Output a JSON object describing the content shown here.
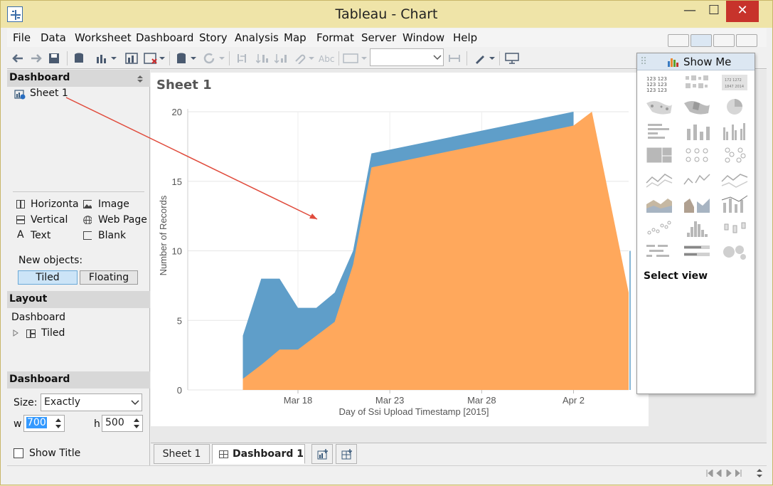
{
  "window": {
    "title": "Tableau - Chart",
    "min": "—",
    "max": "☐",
    "close": "✕"
  },
  "menu": [
    "File",
    "Data",
    "Worksheet",
    "Dashboard",
    "Story",
    "Analysis",
    "Map",
    "Format",
    "Server",
    "Window",
    "Help"
  ],
  "left_panel": {
    "dashboard_header": "Dashboard",
    "sheets": [
      "Sheet 1"
    ],
    "objects": [
      {
        "label": "Horizonta",
        "icon": "horizontal-icon"
      },
      {
        "label": "Image",
        "icon": "image-icon"
      },
      {
        "label": "Vertical",
        "icon": "vertical-icon"
      },
      {
        "label": "Web Page",
        "icon": "globe-icon"
      },
      {
        "label": "Text",
        "icon": "text-icon"
      },
      {
        "label": "Blank",
        "icon": "blank-icon"
      }
    ],
    "new_objects_label": "New objects:",
    "tiled": "Tiled",
    "floating": "Floating",
    "layout_header": "Layout",
    "layout_root": "Dashboard",
    "layout_child": "Tiled",
    "size_header": "Dashboard",
    "size_label": "Size:",
    "size_value": "Exactly",
    "w_label": "w",
    "w_value": "700",
    "h_label": "h",
    "h_value": "500",
    "show_title": "Show Title"
  },
  "sheet_title": "Sheet 1",
  "tabs": {
    "sheet": "Sheet 1",
    "dashboard": "Dashboard 1"
  },
  "show_me": {
    "header": "Show Me",
    "footer": "Select view"
  },
  "chart_data": {
    "type": "area",
    "xlabel": "Day of Ssi Upload Timestamp [2015]",
    "ylabel": "Number of Records",
    "ylim": [
      0,
      20
    ],
    "yticks": [
      "0",
      "5",
      "10",
      "15",
      "20"
    ],
    "xticks": [
      {
        "label": "Mar 18",
        "day": 18
      },
      {
        "label": "Mar 23",
        "day": 23
      },
      {
        "label": "Mar 28",
        "day": 28
      },
      {
        "label": "Apr 2",
        "day": 33
      }
    ],
    "colors": {
      "bottom": "#ffa85c",
      "top": "#5f9ec9"
    },
    "series": [
      {
        "color": "#ffa85c",
        "points": [
          [
            15,
            0.8
          ],
          [
            16,
            1.8
          ],
          [
            17,
            2.9
          ],
          [
            18,
            2.9
          ],
          [
            19,
            3.9
          ],
          [
            20,
            4.9
          ],
          [
            21,
            9
          ],
          [
            22,
            16
          ],
          [
            33,
            19
          ],
          [
            34,
            20
          ],
          [
            36,
            7
          ]
        ]
      },
      {
        "color": "#5f9ec9",
        "points": [
          [
            15,
            3.9
          ],
          [
            16,
            8
          ],
          [
            17,
            8
          ],
          [
            18,
            5.9
          ],
          [
            19,
            5.9
          ],
          [
            20,
            7
          ],
          [
            21,
            10
          ],
          [
            22,
            17
          ],
          [
            33,
            20
          ],
          [
            33,
            19
          ]
        ]
      }
    ]
  }
}
